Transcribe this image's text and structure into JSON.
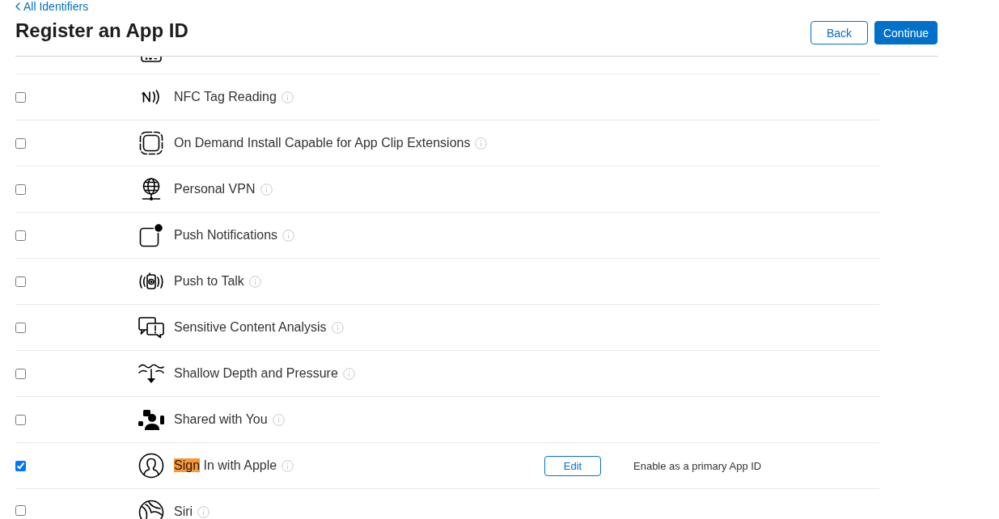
{
  "back_link": {
    "label": "All Identifiers"
  },
  "title": "Register an App ID",
  "buttons": [
    {
      "label": "Back",
      "kind": "secondary"
    },
    {
      "label": "Continue",
      "kind": "primary"
    }
  ],
  "capabilities": [
    {
      "kind": "cut_off"
    },
    {
      "kind": "row",
      "label": "NFC Tag Reading",
      "checked": false
    },
    {
      "kind": "row",
      "label": "On Demand Install Capable for App Clip Extensions",
      "checked": false
    },
    {
      "kind": "row",
      "label": "Personal VPN",
      "checked": false
    },
    {
      "kind": "row",
      "label": "Push Notifications",
      "checked": false
    },
    {
      "kind": "row",
      "label": "Push to Talk",
      "checked": false
    },
    {
      "kind": "row",
      "label": "Sensitive Content Analysis",
      "checked": false
    },
    {
      "kind": "row",
      "label": "Shallow Depth and Pressure",
      "checked": false
    },
    {
      "kind": "row",
      "label": "Shared with You",
      "checked": false
    },
    {
      "kind": "row",
      "label_parts": [
        {
          "text": "Sign",
          "highlighted": true
        },
        {
          "text": "In with Apple",
          "highlighted": false
        }
      ],
      "checked": true,
      "edit_button": {
        "label": "Edit"
      },
      "note": "Enable as a primary App ID"
    },
    {
      "kind": "row",
      "label": "Siri",
      "checked": false
    }
  ]
}
